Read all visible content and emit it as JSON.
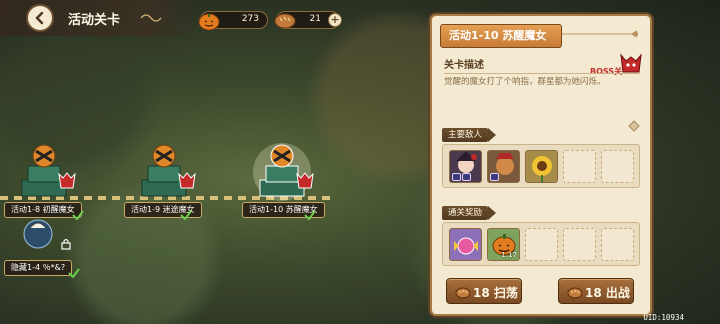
{
  "header": {
    "title": "活动关卡",
    "resources": [
      {
        "icon": "pumpkin-icon",
        "value": "273"
      },
      {
        "icon": "bread-icon",
        "value": "21"
      }
    ]
  },
  "map": {
    "stages": [
      {
        "label": "活动1-8 初醒魔女",
        "cleared": true
      },
      {
        "label": "活动1-9 迷途魔女",
        "cleared": true
      },
      {
        "label": "活动1-10 苏醒魔女",
        "cleared": true,
        "selected": true
      }
    ],
    "hidden_stage": {
      "label": "隐藏1-4 ％*&?"
    }
  },
  "panel": {
    "title": "活动1-10 苏醒魔女",
    "description_label": "关卡描述",
    "boss_label": "BOSS关",
    "description": "觉醒的魔女打了个响指，群星都为她闪烁。",
    "enemies_label": "主要敌人",
    "rewards_label": "通关奖励",
    "rewards": [
      {
        "icon": "candy-icon",
        "count": ""
      },
      {
        "icon": "pumpkin-icon",
        "count": "1.17"
      }
    ],
    "sweep_button": "18 扫荡",
    "battle_button": "18 出战"
  },
  "uid": "UID:10934",
  "colors": {
    "accent": "#c87b36",
    "panel_bg": "#f4ead2",
    "boss_red": "#c42a2a"
  }
}
